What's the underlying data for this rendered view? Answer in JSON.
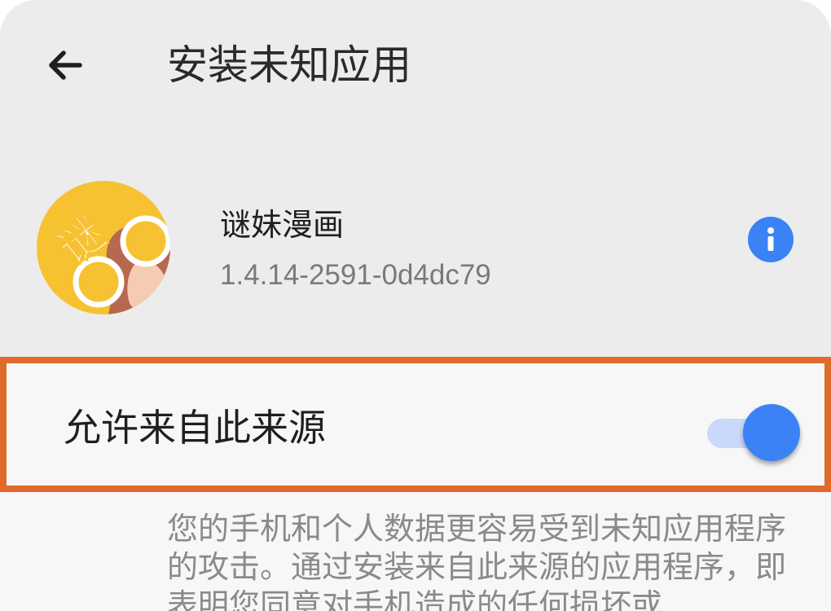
{
  "header": {
    "title": "安装未知应用",
    "back_icon": "arrow-left-icon"
  },
  "app": {
    "name": "谜妹漫画",
    "version": "1.4.14-2591-0d4dc79",
    "icon_char": "谜",
    "info_icon": "info-icon"
  },
  "permission": {
    "label": "允许来自此来源",
    "enabled": true
  },
  "warning_text": "您的手机和个人数据更容易受到未知应用程序的攻击。通过安装来自此来源的应用程序，即表明您同意对手机造成的任何损坏或",
  "colors": {
    "accent": "#3b82f6",
    "highlight_border": "#e06a2a",
    "background": "#ececec"
  }
}
